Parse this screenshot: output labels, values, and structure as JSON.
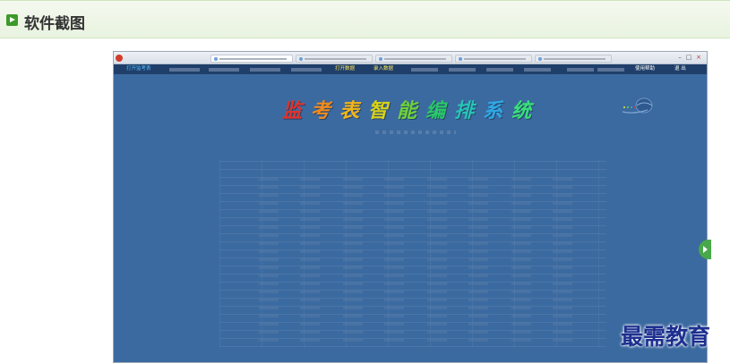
{
  "section": {
    "title": "软件截图"
  },
  "screenshot": {
    "app_title_chars": [
      {
        "char": "监",
        "color": "#e0332e"
      },
      {
        "char": "考",
        "color": "#f08a1f"
      },
      {
        "char": "表",
        "color": "#f3b51b"
      },
      {
        "char": "智",
        "color": "#d8d219"
      },
      {
        "char": "能",
        "color": "#6fd23a"
      },
      {
        "char": "编",
        "color": "#2bc76a"
      },
      {
        "char": "排",
        "color": "#28c3b7"
      },
      {
        "char": "系",
        "color": "#2fa9e6"
      },
      {
        "char": "统",
        "color": "#38e07a"
      }
    ],
    "menu": [
      {
        "label": "打开监考表",
        "color": "cyan"
      },
      {
        "label": "",
        "color": "dim"
      },
      {
        "label": "",
        "color": "dim"
      },
      {
        "label": "",
        "color": "dim"
      },
      {
        "label": "",
        "color": "dim"
      },
      {
        "label": "打开数据",
        "color": "yellow"
      },
      {
        "label": "录入数据",
        "color": "yellow"
      },
      {
        "label": "",
        "color": "dim"
      },
      {
        "label": "",
        "color": "dim"
      },
      {
        "label": "",
        "color": "dim"
      },
      {
        "label": "",
        "color": "dim"
      },
      {
        "label": "",
        "color": "dim"
      },
      {
        "label": "",
        "color": "dim"
      },
      {
        "label": "使用帮助",
        "color": "white"
      },
      {
        "label": "退 出",
        "color": "white"
      }
    ]
  },
  "watermark": "最需教育",
  "colors": {
    "header_bg": "#eef6e8",
    "play_icon": "#3d9a2a",
    "app_bg": "#3b6aa0",
    "menubar_bg": "#1f3f6a",
    "side_tab": "#48a84a",
    "watermark": "#1d2f8f"
  },
  "icons": [
    "play-icon",
    "app-logo-icon",
    "globe-logo-icon",
    "side-tab-arrow-icon"
  ]
}
